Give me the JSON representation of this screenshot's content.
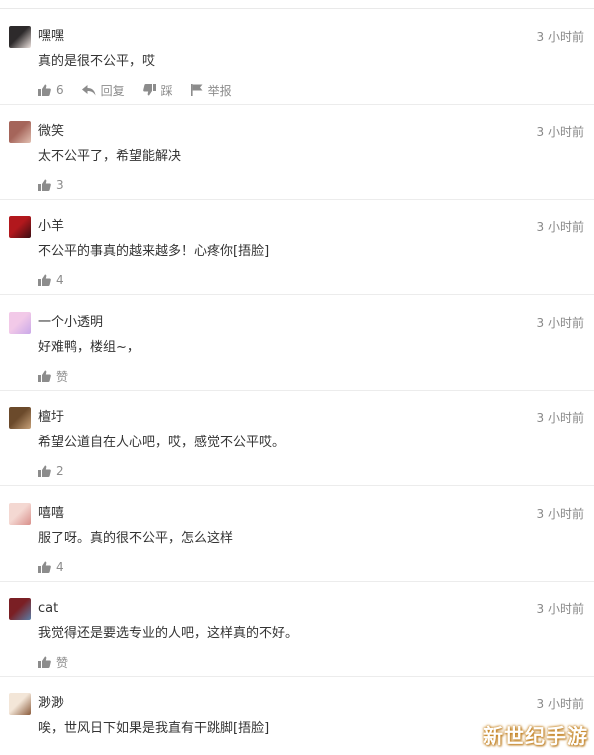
{
  "comments": [
    {
      "user": "嘿嘿",
      "time": "3 小时前",
      "text": "真的是很不公平，哎",
      "likes": "6",
      "reply_label": "回复",
      "dislike_label": "踩",
      "report_label": "举报",
      "avatar_colors": [
        "#2d2a2b",
        "#efe5e1"
      ]
    },
    {
      "user": "微笑",
      "time": "3 小时前",
      "text": "太不公平了，希望能解决",
      "likes": "3",
      "avatar_colors": [
        "#a5655a",
        "#e2c0b2"
      ]
    },
    {
      "user": "小羊",
      "time": "3 小时前",
      "text": "不公平的事真的越来越多！心疼你[捂脸]",
      "likes": "4",
      "avatar_colors": [
        "#b2181d",
        "#3b0d12"
      ]
    },
    {
      "user": "一个小透明",
      "time": "3 小时前",
      "text": "好难鸭，楼组~，",
      "likes": "赞",
      "avatar_colors": [
        "#f2c9e8",
        "#c9a8e8"
      ]
    },
    {
      "user": "檀圩",
      "time": "3 小时前",
      "text": "希望公道自在人心吧，哎，感觉不公平哎。",
      "likes": "2",
      "avatar_colors": [
        "#6b4a2b",
        "#c8a27a"
      ]
    },
    {
      "user": "嘻嘻",
      "time": "3 小时前",
      "text": "服了呀。真的很不公平，怎么这样",
      "likes": "4",
      "avatar_colors": [
        "#f4d8d2",
        "#d88f8a"
      ]
    },
    {
      "user": "cat",
      "time": "3 小时前",
      "text": "我觉得还是要选专业的人吧，这样真的不好。",
      "likes": "赞",
      "avatar_colors": [
        "#7a1f24",
        "#5a7fa8"
      ]
    },
    {
      "user": "渺渺",
      "time": "3 小时前",
      "text": "唉，世风日下如果是我直有干跳脚[捂脸]",
      "likes": "",
      "avatar_colors": [
        "#f3e6d8",
        "#8a5a3a"
      ]
    }
  ],
  "watermark": "新世纪手游",
  "colors": {
    "icon": "#8c8c8c",
    "divider": "#ececec",
    "time": "#888888",
    "text": "#333333"
  }
}
